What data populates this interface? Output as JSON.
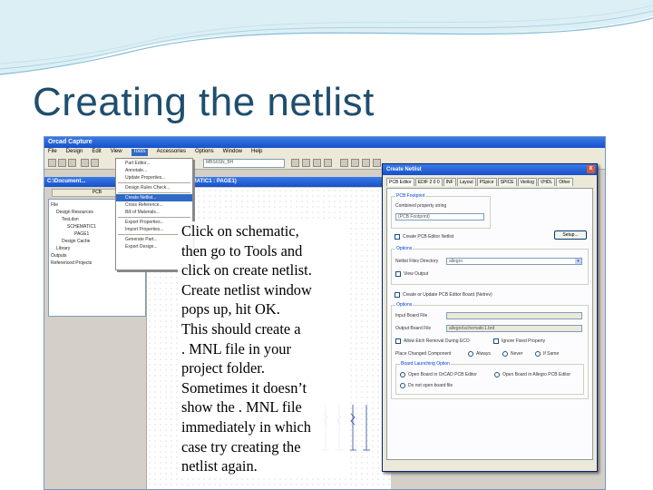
{
  "slide": {
    "title": "Creating the netlist",
    "accent_color": "#1f4e6e",
    "instructions": [
      "Click on schematic,",
      "then go to Tools and",
      "click on create netlist.",
      "Create netlist window",
      "pops up, hit OK.",
      "This should create a",
      ". MNL file in your",
      "project folder.",
      "Sometimes it doesn’t",
      "show the . MNL file",
      "immediately in which",
      "case try creating the",
      "netlist again."
    ]
  },
  "app": {
    "title": "Orcad Capture",
    "menu": [
      "File",
      "Design",
      "Edit",
      "View",
      "Tools",
      "Accessories",
      "Options",
      "Window",
      "Help"
    ],
    "active_menu": "Tools",
    "part_combo": "MBS6SN_BH",
    "project_window_title": "C:\\Document...",
    "project_tab": "PCB",
    "tree_items": [
      "File",
      "Design Resources",
      "Test.dsn",
      "SCHEMATIC1",
      "PAGE1",
      "Design Cache",
      "Library",
      "Outputs",
      "Referenced Projects"
    ],
    "schematic_title": "(SCHEMATIC1 : PAGE1)",
    "tools_menu": {
      "items": [
        "Part Editor...",
        "Annotate...",
        "Update Properties...",
        "Design Rules Check...",
        "Create Netlist...",
        "Cross Reference...",
        "Bill of Materials...",
        "Export Properties...",
        "Import Properties...",
        "Generate Part...",
        "Export Design..."
      ],
      "selected": "Create Netlist..."
    },
    "dialog": {
      "title": "Create Netlist",
      "close_label": "x",
      "tabs": [
        "PCB Editor",
        "EDIF 2 0 0",
        "INF",
        "Layout",
        "PSpice",
        "SPICE",
        "Verilog",
        "VHDL",
        "Other"
      ],
      "active_tab": "PCB Editor",
      "footprint_group": "PCB Footprint",
      "footprint_label": "Combined property string",
      "footprint_value": "{PCB Footprint}",
      "create_netlist_label": "Create PCB Editor Netlist",
      "setup_button": "Setup...",
      "options_group": "Options",
      "netlist_files_label": "Netlist Files Directory",
      "netlist_files_value": "allegro",
      "view_output_label": "View Output",
      "update_board_label": "Create or Update PCB Editor Board (Netrev)",
      "options2_group": "Options",
      "input_board_label": "Input Board File",
      "output_board_label": "Output Board File",
      "output_board_value": "allegro\\schematic1.brd",
      "allow_etch_label": "Allow Etch Removal During ECO",
      "ignore_fixed_label": "Ignore Fixed Property",
      "place_changed_label": "Place Changed Component",
      "place_changed_options": [
        "Always",
        "Never",
        "If Same"
      ],
      "board_launch_group": "Board Launching Option",
      "open_board_label": "Open Board in OrCAD PCB Editor",
      "open_board_allegro_label": "Open Board in Allegro PCB Editor",
      "do_not_open_label": "Do not open board file"
    }
  }
}
